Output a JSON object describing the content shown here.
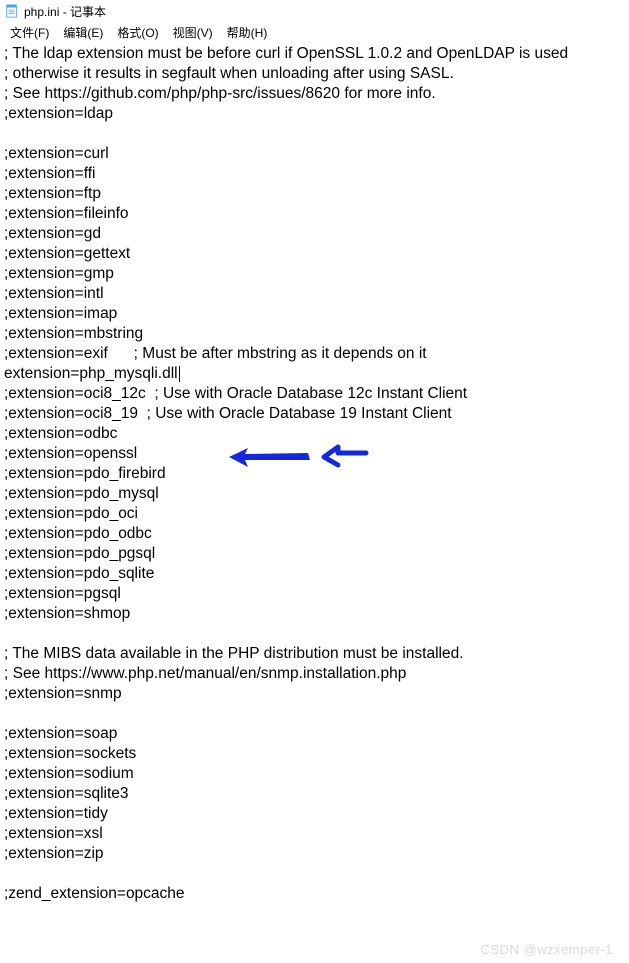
{
  "titlebar": {
    "filename": "php.ini",
    "separator": " - ",
    "appname": "记事本"
  },
  "menubar": {
    "file": "文件(F)",
    "edit": "编辑(E)",
    "format": "格式(O)",
    "view": "视图(V)",
    "help": "帮助(H)"
  },
  "content": {
    "lines": [
      "; The ldap extension must be before curl if OpenSSL 1.0.2 and OpenLDAP is used",
      "; otherwise it results in segfault when unloading after using SASL.",
      "; See https://github.com/php/php-src/issues/8620 for more info.",
      ";extension=ldap",
      "",
      ";extension=curl",
      ";extension=ffi",
      ";extension=ftp",
      ";extension=fileinfo",
      ";extension=gd",
      ";extension=gettext",
      ";extension=gmp",
      ";extension=intl",
      ";extension=imap",
      ";extension=mbstring",
      ";extension=exif      ; Must be after mbstring as it depends on it",
      "extension=php_mysqli.dll",
      ";extension=oci8_12c  ; Use with Oracle Database 12c Instant Client",
      ";extension=oci8_19  ; Use with Oracle Database 19 Instant Client",
      ";extension=odbc",
      ";extension=openssl",
      ";extension=pdo_firebird",
      ";extension=pdo_mysql",
      ";extension=pdo_oci",
      ";extension=pdo_odbc",
      ";extension=pdo_pgsql",
      ";extension=pdo_sqlite",
      ";extension=pgsql",
      ";extension=shmop",
      "",
      "; The MIBS data available in the PHP distribution must be installed.",
      "; See https://www.php.net/manual/en/snmp.installation.php",
      ";extension=snmp",
      "",
      ";extension=soap",
      ";extension=sockets",
      ";extension=sodium",
      ";extension=sqlite3",
      ";extension=tidy",
      ";extension=xsl",
      ";extension=zip",
      "",
      ";zend_extension=opcache"
    ],
    "cursor_line_index": 16
  },
  "annotation": {
    "color": "#1428de"
  },
  "watermark": "CSDN @wzxemper-1"
}
